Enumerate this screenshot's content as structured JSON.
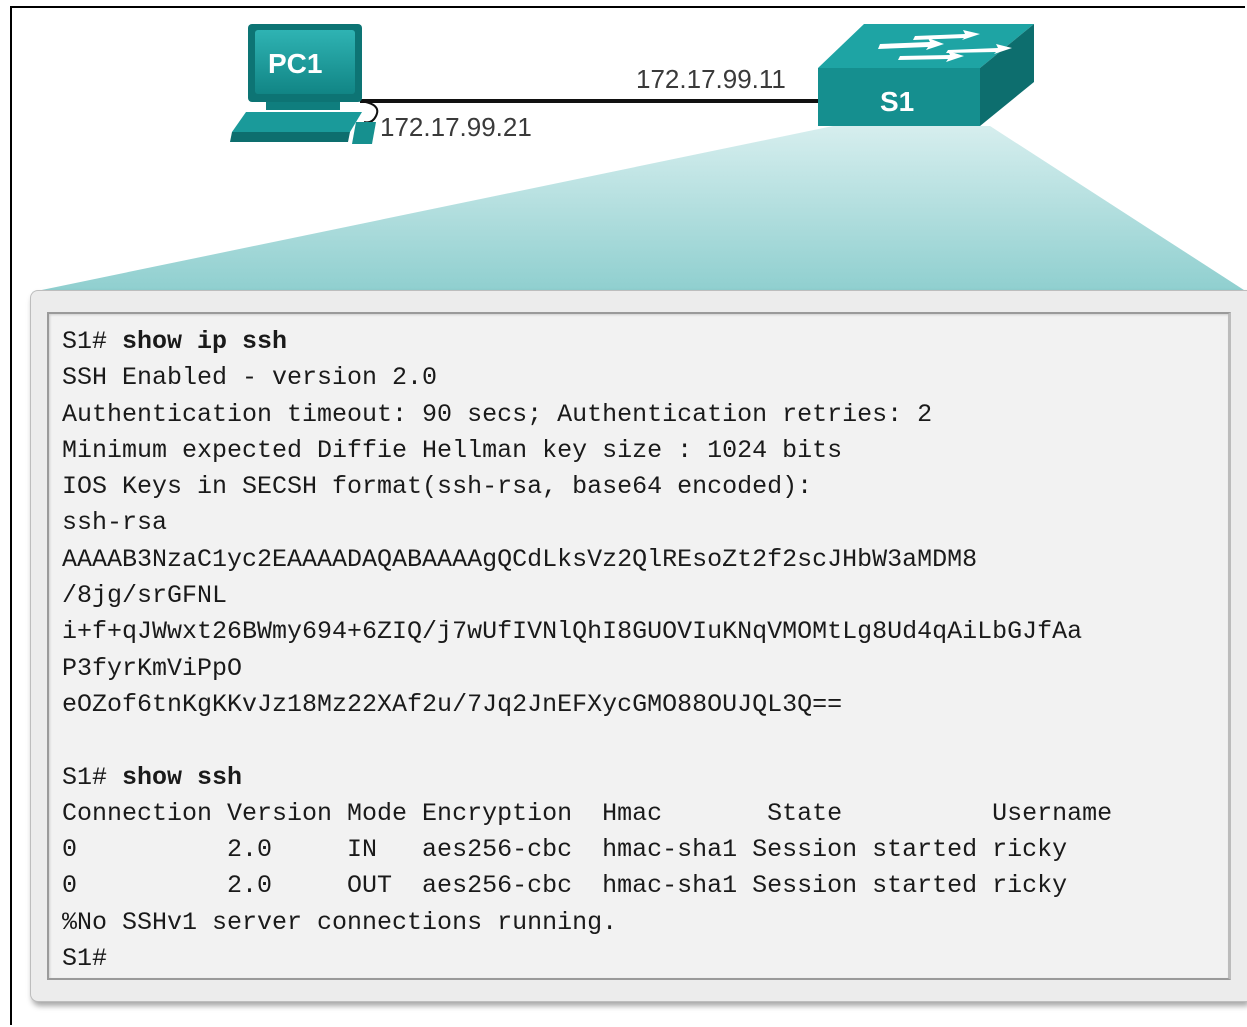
{
  "topology": {
    "pc": {
      "name": "PC1",
      "ip": "172.17.99.21"
    },
    "switch": {
      "name": "S1",
      "ip": "172.17.99.11"
    },
    "colors": {
      "device_teal": "#1a9a9a",
      "device_dark": "#0d6e6e",
      "zoom_cone": "#aedcdc"
    }
  },
  "terminal": {
    "lines": [
      {
        "prompt": "S1# ",
        "cmd": "show ip ssh"
      },
      {
        "text": "SSH Enabled - version 2.0"
      },
      {
        "text": "Authentication timeout: 90 secs; Authentication retries: 2"
      },
      {
        "text": "Minimum expected Diffie Hellman key size : 1024 bits"
      },
      {
        "text": "IOS Keys in SECSH format(ssh-rsa, base64 encoded):"
      },
      {
        "text": "ssh-rsa"
      },
      {
        "text": "AAAAB3NzaC1yc2EAAAADAQABAAAAgQCdLksVz2QlREsoZt2f2scJHbW3aMDM8"
      },
      {
        "text": "/8jg/srGFNL"
      },
      {
        "text": "i+f+qJWwxt26BWmy694+6ZIQ/j7wUfIVNlQhI8GUOVIuKNqVMOMtLg8Ud4qAiLbGJfAa"
      },
      {
        "text": "P3fyrKmViPpO"
      },
      {
        "text": "eOZof6tnKgKKvJz18Mz22XAf2u/7Jq2JnEFXycGMO88OUJQL3Q=="
      },
      {
        "text": ""
      },
      {
        "prompt": "S1# ",
        "cmd": "show ssh"
      },
      {
        "text": "Connection Version Mode Encryption  Hmac       State          Username"
      },
      {
        "text": "0          2.0     IN   aes256-cbc  hmac-sha1 Session started ricky"
      },
      {
        "text": "0          2.0     OUT  aes256-cbc  hmac-sha1 Session started ricky"
      },
      {
        "text": "%No SSHv1 server connections running."
      },
      {
        "text": "S1#"
      }
    ]
  }
}
